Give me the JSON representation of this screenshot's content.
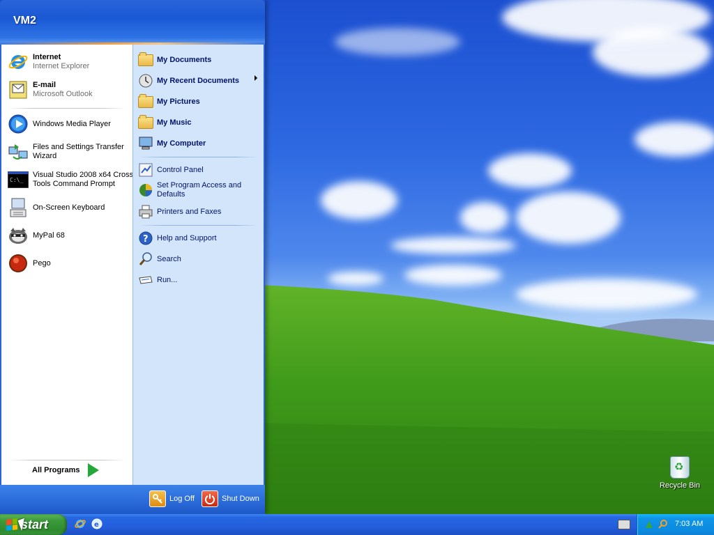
{
  "start_menu": {
    "user_name": "VM2",
    "pinned": [
      {
        "title": "Internet",
        "subtitle": "Internet Explorer",
        "icon": "internet-explorer-icon"
      },
      {
        "title": "E-mail",
        "subtitle": "Microsoft Outlook",
        "icon": "outlook-icon"
      }
    ],
    "recent": [
      {
        "label": "Windows Media Player",
        "icon": "media-player-icon"
      },
      {
        "label": "Files and Settings Transfer Wizard",
        "icon": "transfer-wizard-icon"
      },
      {
        "label": "Visual Studio 2008 x64 Cross Tools Command Prompt",
        "icon": "command-prompt-icon"
      },
      {
        "label": "On-Screen Keyboard",
        "icon": "keyboard-icon"
      },
      {
        "label": "MyPal 68",
        "icon": "mypal-icon"
      },
      {
        "label": "Pego",
        "icon": "pego-icon"
      }
    ],
    "all_programs": "All Programs",
    "places": [
      {
        "label": "My Documents",
        "icon": "folder-icon"
      },
      {
        "label": "My Recent Documents",
        "icon": "recent-documents-icon",
        "submenu": true
      },
      {
        "label": "My Pictures",
        "icon": "folder-icon"
      },
      {
        "label": "My Music",
        "icon": "folder-icon"
      },
      {
        "label": "My Computer",
        "icon": "computer-icon"
      }
    ],
    "settings": [
      {
        "label": "Control Panel",
        "icon": "control-panel-icon"
      },
      {
        "label": "Set Program Access and Defaults",
        "icon": "program-access-icon"
      },
      {
        "label": "Printers and Faxes",
        "icon": "printer-icon"
      }
    ],
    "tools": [
      {
        "label": "Help and Support",
        "icon": "help-icon"
      },
      {
        "label": "Search",
        "icon": "search-icon"
      },
      {
        "label": "Run...",
        "icon": "run-icon"
      }
    ],
    "log_off": "Log Off",
    "shut_down": "Shut Down"
  },
  "desktop": {
    "recycle_bin_label": "Recycle Bin"
  },
  "taskbar": {
    "start_label": "start",
    "clock": "7:03 AM"
  },
  "colors": {
    "taskbar_blue": "#245edb",
    "start_green": "#3c9b3b",
    "tray_blue": "#0f95e8",
    "places_panel": "#d3e5fa"
  }
}
